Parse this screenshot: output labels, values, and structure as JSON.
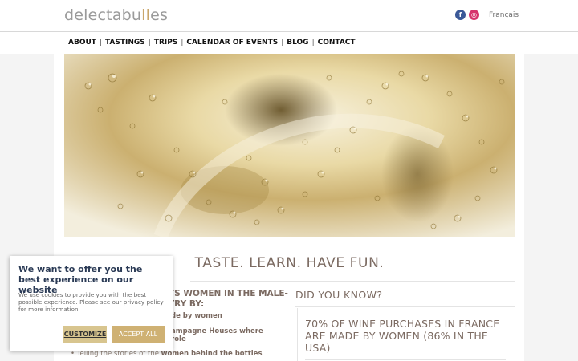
{
  "header": {
    "logo_prefix": "delectabu",
    "logo_accent": "ll",
    "logo_suffix": "es",
    "facebook_icon": "facebook-icon",
    "instagram_icon": "instagram-icon",
    "language": "Français"
  },
  "nav": {
    "items": [
      "ABOUT",
      "TASTINGS",
      "TRIPS",
      "CALENDAR OF EVENTS",
      "BLOG",
      "CONTACT"
    ]
  },
  "hero": {
    "image": "champagne-bubbles-image"
  },
  "main": {
    "tagline": "TASTE. LEARN. HAVE FUN.",
    "left_heading": "TS WOMEN IN THE MALE-TRY BY:",
    "left_list": [
      {
        "pre": "",
        "bold": "de by women",
        "post": ""
      },
      {
        "pre": "",
        "bold": "ampagne Houses where",
        "post": ""
      },
      {
        "pre": "",
        "bold": "role",
        "post": ""
      },
      {
        "pre": "Telling the stories of the ",
        "bold": "women behind the bottles",
        "post": ""
      }
    ],
    "did_you_know": "DID YOU KNOW?",
    "fact": "70% OF WINE PURCHASES IN FRANCE ARE MADE BY WOMEN (86% IN THE USA)"
  },
  "cookie": {
    "title": "We want to offer you the best experience on our website",
    "text": "We use cookies to provide you with the best possible experience. Please see our privacy policy for more information.",
    "customize": "CUSTOMIZE",
    "accept": "ACCEPT ALL"
  },
  "colors": {
    "accent_gold": "#cfb173",
    "text_brown": "#7b6a61",
    "cookie_title": "#2a3a55"
  }
}
